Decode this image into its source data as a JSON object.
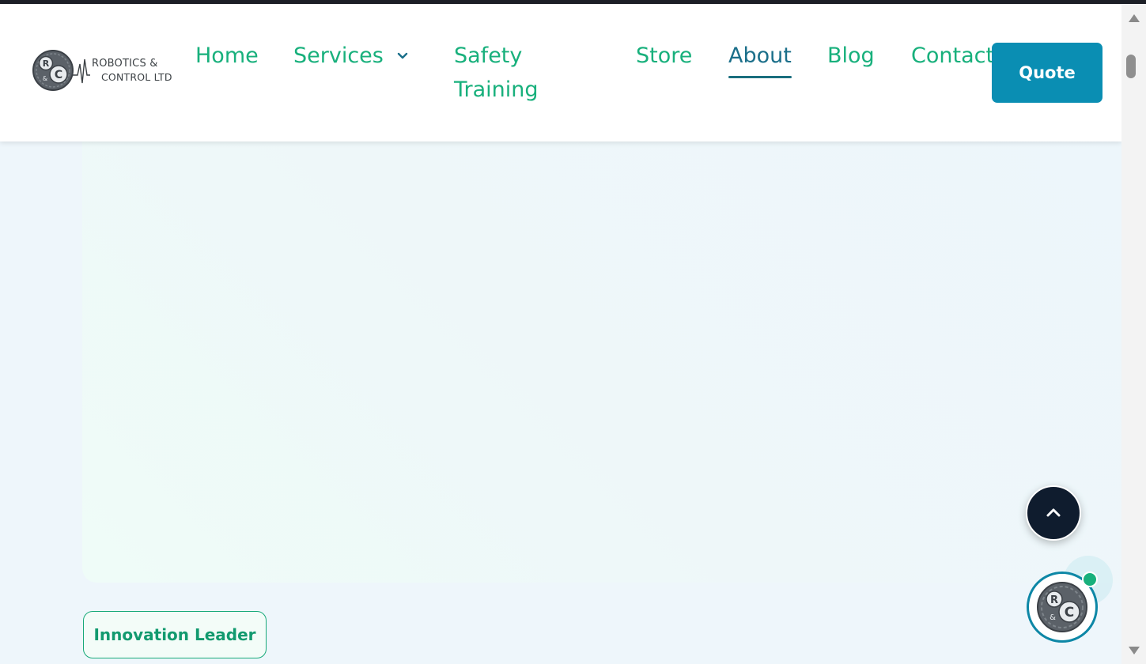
{
  "header": {
    "logo": {
      "line1": "ROBOTICS &",
      "line2": "CONTROL LTD",
      "mark_letters": [
        "R",
        "&",
        "C"
      ]
    },
    "nav": {
      "home": "Home",
      "services": "Services",
      "safety_training": "Safety Training",
      "store": "Store",
      "about": "About",
      "blog": "Blog",
      "contact": "Contact"
    },
    "active_nav": "About",
    "quote_button": "Quote"
  },
  "main": {
    "badge": "Innovation Leader"
  },
  "floating": {
    "scroll_top_icon": "chevron-up-icon",
    "chat_icon": "company-logo-icon",
    "chat_status": "online"
  },
  "colors": {
    "nav_text": "#18b07c",
    "nav_active": "#1b6f8a",
    "quote_bg": "#0a8eb3",
    "scroll_top_bg": "#0f1c2e",
    "status_dot": "#18b07c"
  }
}
